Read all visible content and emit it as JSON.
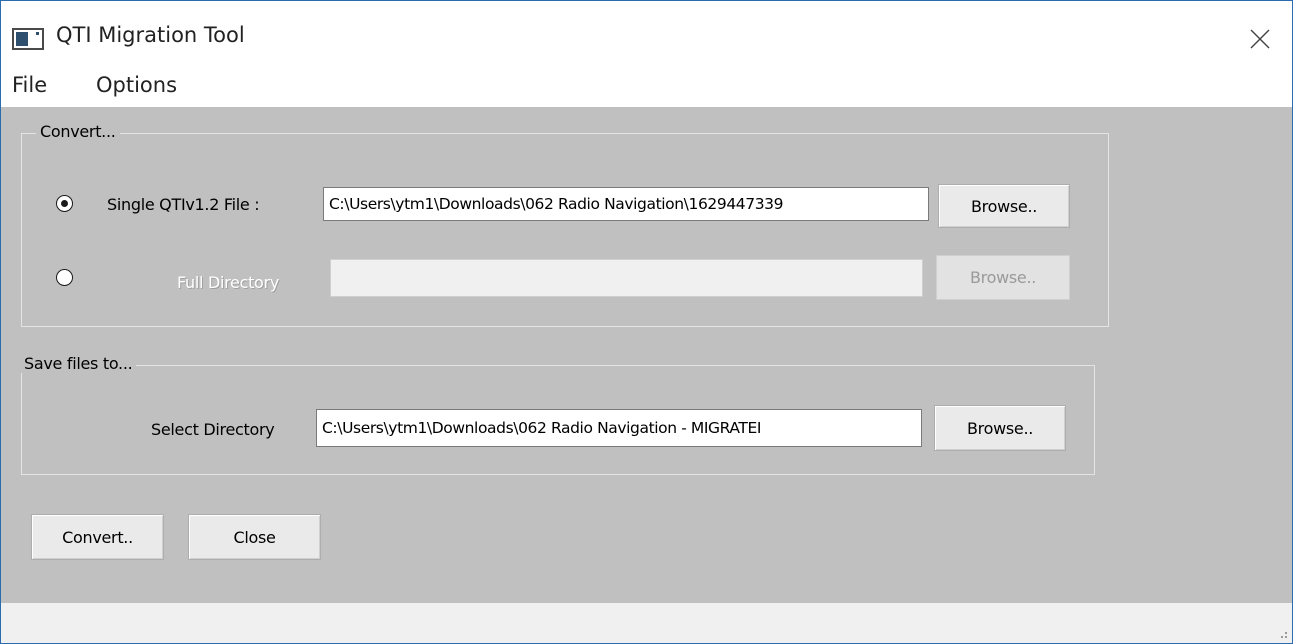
{
  "window": {
    "title": "QTI Migration Tool",
    "icon": "app-window-icon",
    "close_icon": "close-icon"
  },
  "menu": {
    "file": "File",
    "options": "Options"
  },
  "convert_group": {
    "legend": "Convert...",
    "single": {
      "label": "Single QTIv1.2 File :",
      "value": "C:\\Users\\ytm1\\Downloads\\062 Radio Navigation\\1629447339",
      "checked": true,
      "browse_label": "Browse.."
    },
    "full": {
      "label": "Full Directory",
      "value": "",
      "checked": false,
      "browse_label": "Browse.."
    }
  },
  "save_group": {
    "legend": "Save files to...",
    "label": "Select Directory",
    "value": "C:\\Users\\ytm1\\Downloads\\062 Radio Navigation - MIGRATEI",
    "browse_label": "Browse.."
  },
  "actions": {
    "convert_label": "Convert..",
    "close_label": "Close"
  },
  "colors": {
    "client_background": "#c0c0c0",
    "window_border": "#2b6cb0"
  }
}
